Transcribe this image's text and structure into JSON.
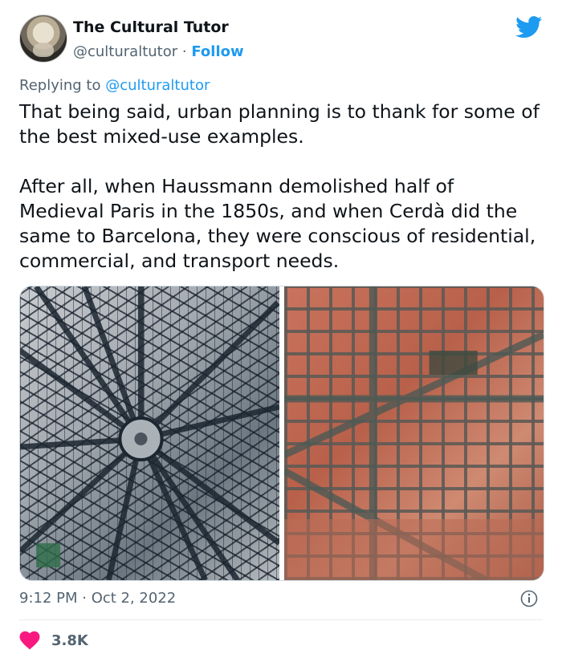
{
  "author": {
    "name": "The Cultural Tutor",
    "handle": "@culturaltutor",
    "separator": "·",
    "follow_label": "Follow"
  },
  "reply": {
    "prefix": "Replying to",
    "mention": "@culturaltutor"
  },
  "tweet": {
    "paragraph1": "That being said, urban planning is to thank for some of the best mixed-use examples.",
    "paragraph2": "After all, when Haussmann demolished half of Medieval Paris in the 1850s, and when Cerdà did the same to Barcelona, they were conscious of residential, commercial, and transport needs."
  },
  "media": {
    "images": [
      "paris-aerial",
      "barcelona-aerial"
    ]
  },
  "meta": {
    "timestamp": "9:12 PM · Oct 2, 2022"
  },
  "engagement": {
    "likes": "3.8K"
  },
  "colors": {
    "accent": "#1d9bf0",
    "heart": "#f91880",
    "muted": "#536471"
  },
  "icons": [
    "twitter-bird-icon",
    "info-icon",
    "heart-icon"
  ]
}
